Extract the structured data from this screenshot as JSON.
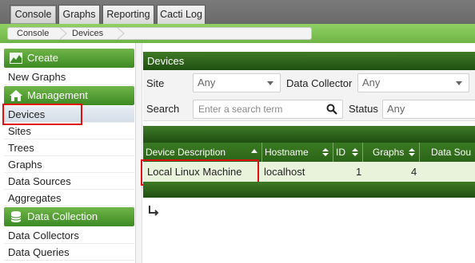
{
  "top_tabs": [
    "Console",
    "Graphs",
    "Reporting",
    "Cacti Log"
  ],
  "breadcrumb": [
    "Console",
    "Devices"
  ],
  "sidebar": {
    "new_graphs": "New Graphs",
    "management": "Management",
    "management_items": [
      "Devices",
      "Sites",
      "Trees",
      "Graphs",
      "Data Sources",
      "Aggregates"
    ],
    "data_collection": "Data Collection",
    "collection_items": [
      "Data Collectors",
      "Data Queries"
    ],
    "console_header": "Create"
  },
  "panel_title": "Devices",
  "filters": {
    "site_label": "Site",
    "site_value": "Any",
    "collector_label": "Data Collector",
    "collector_value": "Any",
    "search_label": "Search",
    "search_placeholder": "Enter a search term",
    "status_label": "Status",
    "status_value": "Any"
  },
  "table": {
    "columns": [
      "Device Description",
      "Hostname",
      "ID",
      "Graphs",
      "Data Sou"
    ],
    "rows": [
      {
        "description": "Local Linux Machine",
        "hostname": "localhost",
        "id": "1",
        "graphs": "4"
      }
    ]
  },
  "colors": {
    "accent_green": "#3f7a26",
    "highlight_red": "#e01010"
  }
}
